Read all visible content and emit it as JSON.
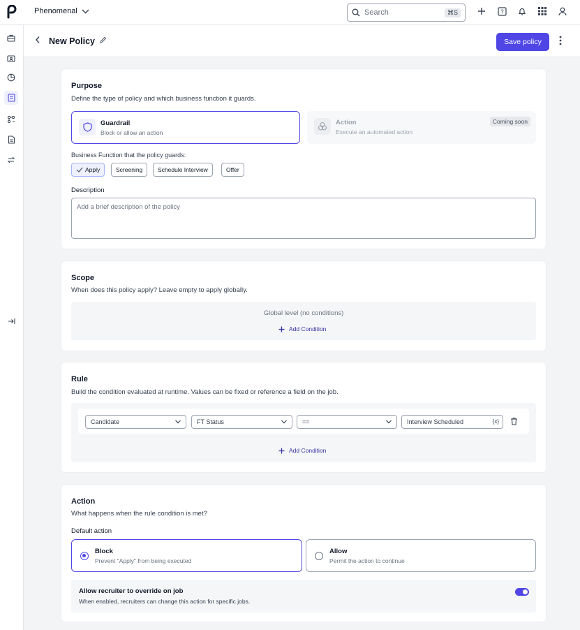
{
  "topbar": {
    "org_name": "Phenomenal",
    "search_placeholder": "Search",
    "search_shortcut": "⌘S"
  },
  "header": {
    "title": "New Policy",
    "save_label": "Save policy"
  },
  "purpose": {
    "title": "Purpose",
    "subtitle": "Define the type of policy and which business function it guards.",
    "options": [
      {
        "title": "Guardrail",
        "desc": "Block or allow an action",
        "icon": "shield-icon",
        "selected": true
      },
      {
        "title": "Action",
        "desc": "Execute an automated action",
        "icon": "circles-icon",
        "badge": "Coming soon",
        "disabled": true
      }
    ],
    "function_label": "Business Function that the policy guards:",
    "functions": [
      {
        "label": "Apply",
        "selected": true
      },
      {
        "label": "Screening",
        "selected": false
      },
      {
        "label": "Schedule Interview",
        "selected": false
      },
      {
        "label": "Offer",
        "selected": false
      }
    ],
    "description_label": "Description",
    "description_placeholder": "Add a brief description of the policy"
  },
  "scope": {
    "title": "Scope",
    "subtitle": "When does this policy apply? Leave empty to apply globally.",
    "global_text": "Global level (no conditions)",
    "add_condition": "Add Condition"
  },
  "rule": {
    "title": "Rule",
    "subtitle": "Build the condition evaluated at runtime. Values can be fixed or reference a field on the job.",
    "condition": {
      "entity": "Candidate",
      "field": "FT Status",
      "operator": "==",
      "value": "Interview Scheduled",
      "value_token": "{x}"
    },
    "add_condition": "Add Condition"
  },
  "action": {
    "title": "Action",
    "subtitle": "What happens when the rule condition is met?",
    "default_label": "Default action",
    "options": [
      {
        "title": "Block",
        "desc": "Prevent \"Apply\" from being executed",
        "selected": true
      },
      {
        "title": "Allow",
        "desc": "Permit the action to continue",
        "selected": false
      }
    ],
    "override_title": "Allow recruiter to override on job",
    "override_desc": "When enabled, recruiters can change this action for specific jobs.",
    "override_enabled": true
  },
  "colors": {
    "accent": "#4f46e5",
    "selected_border": "#4f46e5",
    "background": "#f3f4f6"
  }
}
